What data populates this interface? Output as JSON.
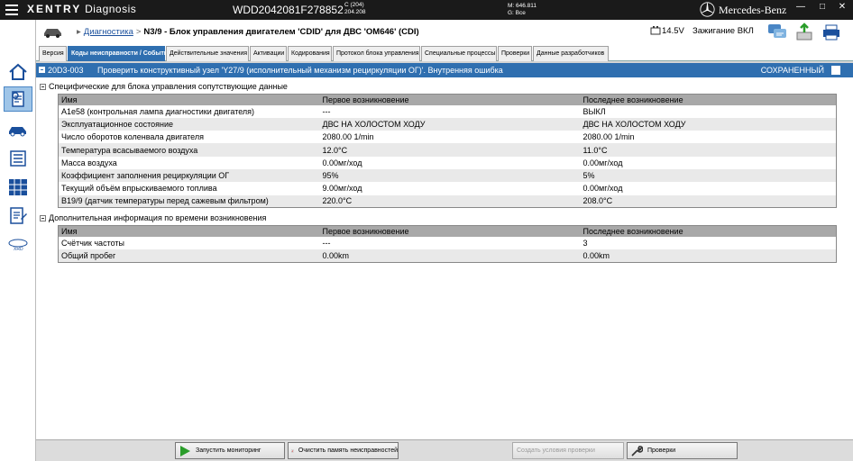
{
  "app": {
    "brand_bold": "XENTRY",
    "brand_rest": "Diagnosis",
    "vin": "WDD2042081F278852",
    "model_line1": "C (204)",
    "model_line2": "204.208",
    "mileage_line1": "M: 646.811",
    "mileage_line2": "G: Все",
    "maker": "Mercedes-Benz"
  },
  "header": {
    "breadcrumb_root": "Диагностика",
    "breadcrumb_current": "N3/9 - Блок управления двигателем 'CDID' для ДВС 'OM646' (CDI)",
    "voltage": "14.5V",
    "ignition": "Зажигание ВКЛ"
  },
  "tabs": [
    {
      "label": "Версия"
    },
    {
      "label": "Коды неисправности / События"
    },
    {
      "label": "Действительные значения"
    },
    {
      "label": "Активации"
    },
    {
      "label": "Кодирования"
    },
    {
      "label": "Протокол блока управления"
    },
    {
      "label": "Специальные процессы"
    },
    {
      "label": "Проверки"
    },
    {
      "label": "Данные разработчиков"
    }
  ],
  "fault": {
    "code": "20D3-003",
    "description": "Проверить конструктивный узел 'Y27/9 (исполнительный механизм рециркуляции ОГ)'. Внутренняя ошибка",
    "status": "СОХРАНЕННЫЙ"
  },
  "section1": {
    "title": "Специфические для блока управления сопутствующие данные",
    "columns": [
      "Имя",
      "Первое возникновение",
      "Последнее возникновение"
    ],
    "rows": [
      [
        "A1e58 (контрольная лампа диагностики двигателя)",
        "---",
        "ВЫКЛ"
      ],
      [
        "Эксплуатационное состояние",
        "ДВС НА ХОЛОСТОМ ХОДУ",
        "ДВС НА ХОЛОСТОМ ХОДУ"
      ],
      [
        "Число оборотов коленвала двигателя",
        "2080.00 1/min",
        "2080.00 1/min"
      ],
      [
        "Температура всасываемого воздуха",
        "12.0°C",
        "11.0°C"
      ],
      [
        "Масса воздуха",
        "0.00мг/ход",
        "0.00мг/ход"
      ],
      [
        "Коэффициент заполнения рециркуляции ОГ",
        "95%",
        "5%"
      ],
      [
        "Текущий объём впрыскиваемого топлива",
        "9.00мг/ход",
        "0.00мг/ход"
      ],
      [
        "B19/9 (датчик температуры перед сажевым фильтром)",
        "220.0°C",
        "208.0°C"
      ]
    ]
  },
  "section2": {
    "title": "Дополнительная информация по времени возникновения",
    "columns": [
      "Имя",
      "Первое возникновение",
      "Последнее возникновение"
    ],
    "rows": [
      [
        "Счётчик частоты",
        "---",
        "3"
      ],
      [
        "Общий пробег",
        "0.00km",
        "0.00km"
      ]
    ]
  },
  "footer": {
    "start_monitoring": "Запустить мониторинг",
    "clear_memory": "Очистить память неисправностей",
    "create_conditions": "Создать условия проверки",
    "checks": "Проверки"
  }
}
